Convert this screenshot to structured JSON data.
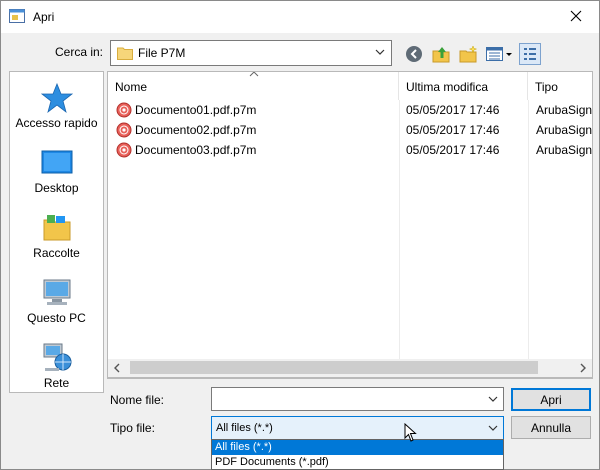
{
  "window": {
    "title": "Apri",
    "title_icon": "open-dialog-icon",
    "close_icon": "close-icon"
  },
  "lookin": {
    "label": "Cerca in:",
    "value": "File P7M",
    "icon": "folder-icon"
  },
  "toolbar": {
    "buttons": [
      {
        "name": "back-icon"
      },
      {
        "name": "up-folder-icon"
      },
      {
        "name": "new-folder-icon"
      },
      {
        "name": "view-menu-icon"
      },
      {
        "name": "details-view-icon"
      }
    ]
  },
  "places": [
    {
      "label": "Accesso rapido",
      "icon": "star-icon"
    },
    {
      "label": "Desktop",
      "icon": "desktop-icon"
    },
    {
      "label": "Raccolte",
      "icon": "libraries-icon"
    },
    {
      "label": "Questo PC",
      "icon": "computer-icon"
    },
    {
      "label": "Rete",
      "icon": "network-icon"
    }
  ],
  "filelist": {
    "columns": [
      "Nome",
      "Ultima modifica",
      "Tipo"
    ],
    "rows": [
      {
        "name": "Documento01.pdf.p7m",
        "date": "05/05/2017 17:46",
        "type": "ArubaSign"
      },
      {
        "name": "Documento02.pdf.p7m",
        "date": "05/05/2017 17:46",
        "type": "ArubaSign"
      },
      {
        "name": "Documento03.pdf.p7m",
        "date": "05/05/2017 17:46",
        "type": "ArubaSign"
      }
    ]
  },
  "filename": {
    "label": "Nome file:",
    "value": ""
  },
  "filetype": {
    "label": "Tipo file:",
    "value": "All files (*.*)",
    "options": [
      "All files (*.*)",
      "PDF Documents (*.pdf)"
    ]
  },
  "buttons": {
    "open": "Apri",
    "cancel": "Annulla"
  },
  "colors": {
    "accent": "#0078d7",
    "selection": "#0078d7",
    "hover_bg": "#e5f1fb"
  }
}
